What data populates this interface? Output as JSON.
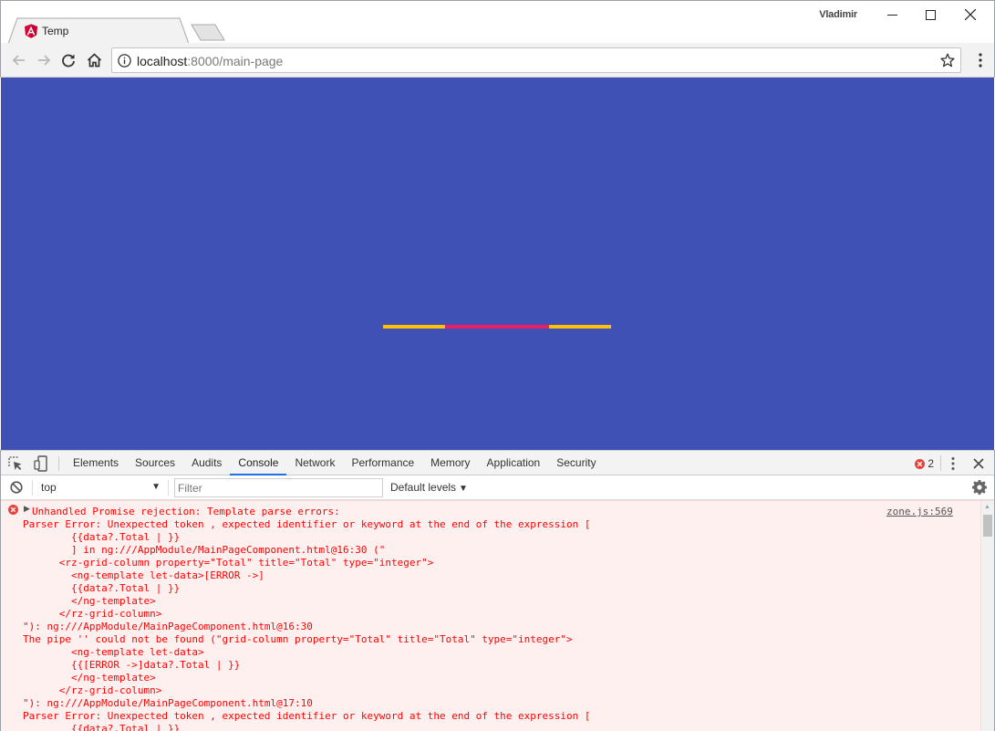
{
  "browser": {
    "tab_title": "Temp",
    "user_name": "Vladimir",
    "url_host": "localhost",
    "url_rest": ":8000/main-page"
  },
  "page": {
    "background": "#3f51b5",
    "loader_colors": [
      "#ffc107",
      "#e91e63",
      "#ffc107"
    ]
  },
  "devtools": {
    "tabs": [
      {
        "label": "Elements",
        "active": false
      },
      {
        "label": "Sources",
        "active": false
      },
      {
        "label": "Audits",
        "active": false
      },
      {
        "label": "Console",
        "active": true
      },
      {
        "label": "Network",
        "active": false
      },
      {
        "label": "Performance",
        "active": false
      },
      {
        "label": "Memory",
        "active": false
      },
      {
        "label": "Application",
        "active": false
      },
      {
        "label": "Security",
        "active": false
      }
    ],
    "error_count": "2",
    "context": "top",
    "filter_placeholder": "Filter",
    "levels_label": "Default levels"
  },
  "console": {
    "source": "zone.js:569",
    "lines": [
      "Unhandled Promise rejection: Template parse errors:",
      "Parser Error: Unexpected token , expected identifier or keyword at the end of the expression [",
      "        {{data?.Total | }}",
      "        ] in ng:///AppModule/MainPageComponent.html@16:30 (\"",
      "      <rz-grid-column property=\"Total\" title=\"Total\" type=\"integer\">",
      "        <ng-template let-data>[ERROR ->]",
      "        {{data?.Total | }}",
      "        </ng-template>",
      "      </rz-grid-column>",
      "\"): ng:///AppModule/MainPageComponent.html@16:30",
      "The pipe '' could not be found (\"grid-column property=\"Total\" title=\"Total\" type=\"integer\">",
      "        <ng-template let-data>",
      "        {{[ERROR ->]data?.Total | }}",
      "        </ng-template>",
      "      </rz-grid-column>",
      "\"): ng:///AppModule/MainPageComponent.html@17:10",
      "Parser Error: Unexpected token , expected identifier or keyword at the end of the expression [",
      "        {{data?.Total | }}"
    ]
  }
}
